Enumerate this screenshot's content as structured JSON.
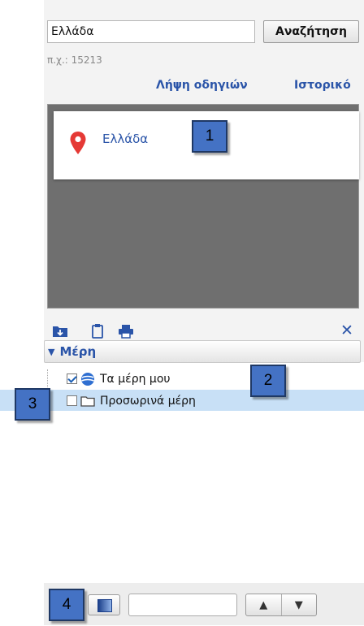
{
  "search": {
    "value": "Ελλάδα",
    "button_label": "Αναζήτηση",
    "example_hint": "π.χ.: 15213"
  },
  "links": {
    "directions": "Λήψη οδηγιών",
    "history": "Ιστορικό"
  },
  "results": [
    {
      "label": "Ελλάδα",
      "icon": "map-pin-icon"
    }
  ],
  "toolbar": {
    "icons": [
      "save-to-folder-icon",
      "copy-icon",
      "print-icon"
    ],
    "close_symbol": "✕"
  },
  "places": {
    "header_label": "Μέρη",
    "items": [
      {
        "label": "Τα μέρη μου",
        "checked": true,
        "icon": "globe-icon"
      },
      {
        "label": "Προσωρινά μέρη",
        "checked": false,
        "icon": "folder-icon"
      }
    ]
  },
  "bottom": {
    "up_symbol": "▲",
    "down_symbol": "▼"
  },
  "callouts": [
    "1",
    "2",
    "3",
    "4"
  ],
  "colors": {
    "link": "#2a54a8",
    "callout_fill": "#4472c4",
    "pin": "#e53935",
    "highlight": "#c8e0f6"
  }
}
